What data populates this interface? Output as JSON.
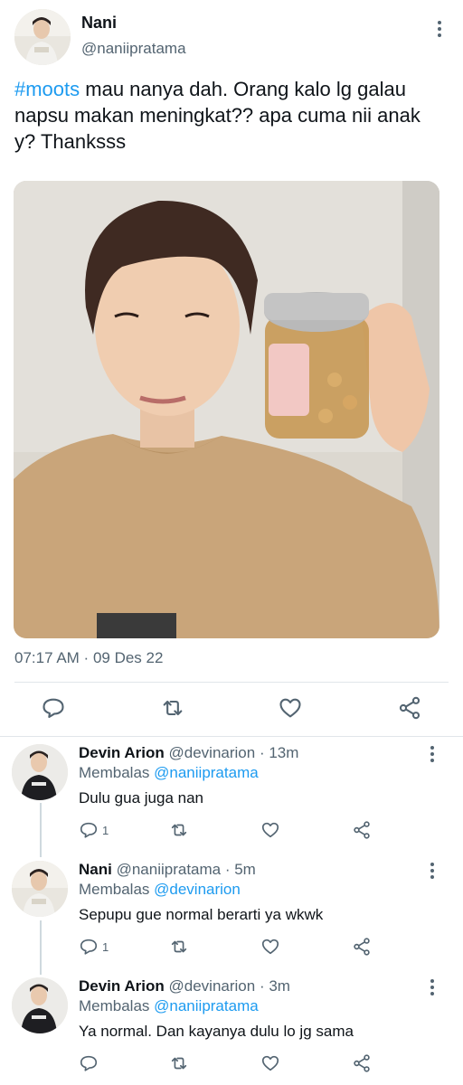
{
  "tweet": {
    "author_name": "Nani",
    "author_handle": "@naniipratama",
    "hashtag": "#moots",
    "text_line1_rest": " mau nanya dah. Orang kalo lg galau",
    "text_line2": "napsu makan meningkat?? apa cuma nii anak",
    "text_line3": "y? Thanksss",
    "time": "07:17 AM",
    "date_separator": " · ",
    "date": "09 Des 22",
    "actions": [
      "reply-icon",
      "retweet-icon",
      "like-icon",
      "share-icon"
    ]
  },
  "replies": [
    {
      "name": "Devin Arion",
      "handle": "@devinarion",
      "time": " · 13m",
      "replying_label": "Membalas ",
      "replying_to": "@naniipratama",
      "text": "Dulu gua juga nan",
      "reply_count": "1"
    },
    {
      "name": "Nani",
      "handle": "@naniipratama",
      "time": " · 5m",
      "replying_label": "Membalas ",
      "replying_to": "@devinarion",
      "text": "Sepupu gue normal berarti ya wkwk",
      "reply_count": "1"
    },
    {
      "name": "Devin Arion",
      "handle": "@devinarion",
      "time": " · 3m",
      "replying_label": "Membalas ",
      "replying_to": "@naniipratama",
      "text": "Ya normal. Dan kayanya dulu lo jg sama",
      "reply_count": ""
    }
  ],
  "colors": {
    "link": "#1d9bf0",
    "secondary_text": "#536471",
    "icon": "#536471"
  }
}
